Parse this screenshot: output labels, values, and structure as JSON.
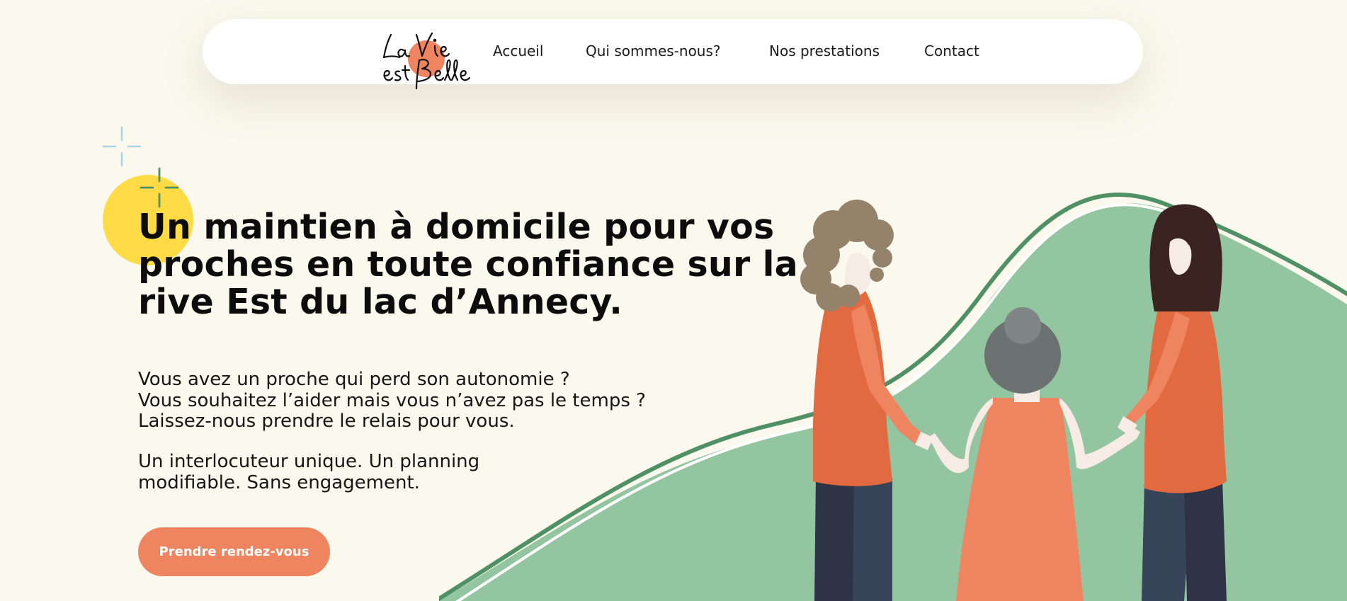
{
  "nav": {
    "logo_text": "La Vie est Belle",
    "items": [
      {
        "label": "Accueil"
      },
      {
        "label": "Qui sommes-nous?"
      },
      {
        "label": "Nos prestations"
      },
      {
        "label": "Contact"
      }
    ]
  },
  "hero": {
    "title": "Un maintien à domicile pour vos proches en toute confiance sur la rive Est du lac d’Annecy.",
    "intro_lines": [
      "Vous avez un proche qui perd son autonomie ?",
      "Vous souhaitez l’aider mais vous n’avez pas le temps ?",
      "Laissez-nous prendre le relais pour vous."
    ],
    "tagline": "Un interlocuteur unique. Un planning modifiable. Sans engagement.",
    "cta_label": "Prendre rendez-vous"
  },
  "colors": {
    "background": "#fbf8ed",
    "accent_orange": "#ef8460",
    "dark_orange": "#e26a40",
    "sun_yellow": "#ffdc45",
    "hill_green": "#93c5a0",
    "hill_line_green": "#4f9165",
    "sparkle_blue": "#a8d4e6",
    "sparkle_green": "#4f9165"
  },
  "icons": {
    "logo": "la-vie-est-belle-logo",
    "sparkle_light": "sparkle-plus-icon",
    "sparkle_dark": "sparkle-plus-icon"
  }
}
